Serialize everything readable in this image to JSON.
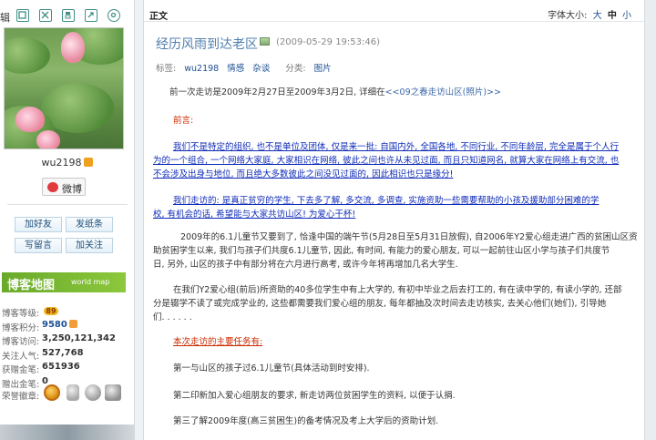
{
  "toolbar": {
    "label": "辑"
  },
  "icons": {
    "toolbar": [
      "window-icon",
      "expand-icon",
      "save-icon",
      "share-icon",
      "settings-icon"
    ]
  },
  "profile": {
    "username": "wu2198",
    "weibo_label": "微博",
    "buttons": [
      "加好友",
      "发纸条",
      "写留言",
      "加关注"
    ]
  },
  "map_banner": {
    "title": "博客地图",
    "subtitle": "world map"
  },
  "stats": [
    {
      "label": "博客等级:",
      "value": "89"
    },
    {
      "label": "博客积分:",
      "value": "9580"
    },
    {
      "label": "博客访问:",
      "value": "3,250,121,342"
    },
    {
      "label": "关注人气:",
      "value": "527,768"
    },
    {
      "label": "获赠金笔:",
      "value": "651936"
    },
    {
      "label": "赠出金笔:",
      "value": "0"
    }
  ],
  "badges_label": "荣誉徽章:",
  "article": {
    "header": "正文",
    "fontsize_label": "字体大小:",
    "fontsize_options": [
      "大",
      "中",
      "小"
    ],
    "title": "经历风雨到达老区",
    "timestamp": "(2009-05-29 19:53:46)",
    "tags_label": "标签:",
    "tags": [
      "wu2198",
      "情感",
      "杂谈"
    ],
    "category_label": "分类:",
    "category": "图片",
    "paragraphs": [
      {
        "text": "前一次走访是2009年2月27日至2009年3月2日, 详细在",
        "link": "<<09之春走访山区(照片)>>"
      },
      {
        "text": "前言:"
      },
      {
        "text": "我们不是特定的组织, 也不是单位及团体, 仅是来一批: 自国内外, 全国各地, 不同行业, 不同年龄层, 完全是属于个人行"
      },
      {
        "text": "为的一个组合, 一个网络大家庭, 大家相识在网络, 彼此之间也许从未见过面, 而且只知道网名, 就算大家在网络上有交流, 也"
      },
      {
        "text": "不会涉及出身与地位, 而且绝大多数彼此之间没见过面的, 因此相识也只是缘分!"
      },
      {
        "text": "我们走访的: 是真正贫穷的学生, 下去多了解, 多交流, 多调查, 实施资助一些需要帮助的小孩及援助部分困难的学"
      },
      {
        "text": "校, 有机会的话, 希望能与大家共访山区! 为爱心干杯!"
      },
      {
        "text": "2009年的6.1儿童节又要到了, 恰逢中国的端午节(5月28日至5月31日放假), 自2006年Y2爱心组走进广西的贫困山区资"
      },
      {
        "text": "助贫困学生以来, 我们与孩子们共度6.1儿童节, 因此, 有时间, 有能力的爱心朋友, 可以一起前往山区小学与孩子们共度节"
      },
      {
        "text": "日, 另外, 山区的孩子中有部分将在六月进行高考, 或许今年将再增加几名大学生."
      },
      {
        "text": "在我们Y2爱心组(前后)所资助的40多位学生中有上大学的, 有初中毕业之后去打工的, 有在读中学的, 有读小学的, 还部"
      },
      {
        "text": "分是辍学不读了或完成学业的, 这些都需要我们爱心组的朋友, 每年都抽及次时间去走访核实, 去关心他们(她们), 引导她"
      },
      {
        "text": "们. . . . . ."
      },
      {
        "text": "本次走访的主要任务有:"
      },
      {
        "text": "第一与山区的孩子过6.1儿童节(具体活动到时安排)."
      },
      {
        "text": "第二印新加入爱心组朋友的要求, 新走访两位贫困学生的资料, 以便于认捐."
      },
      {
        "text": "第三了解2009年度(高三贫困生)的备考情况及考上大学后的资助计划."
      }
    ]
  },
  "colors": {
    "title_blue": "#4f7fae",
    "link_blue": "#0f2bb8",
    "red_heading": "#cc2a00",
    "map_green": "#7ab833"
  }
}
